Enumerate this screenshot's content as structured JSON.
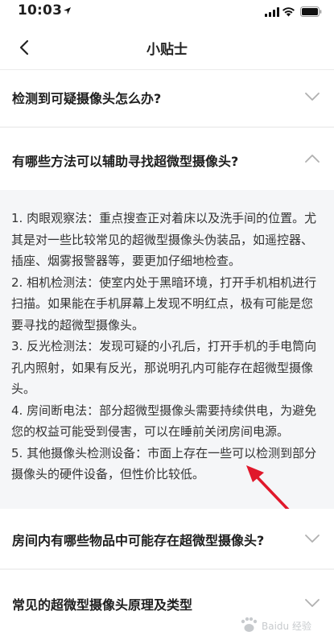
{
  "status_bar": {
    "time": "10:03"
  },
  "header": {
    "title": "小贴士"
  },
  "faq": [
    {
      "question": "检测到可疑摄像头怎么办?",
      "expanded": false
    },
    {
      "question": "有哪些方法可以辅助寻找超微型摄像头?",
      "expanded": true,
      "answer_lines": [
        "1. 肉眼观察法：重点搜查正对着床以及洗手间的位置。尤其是对一些比较常见的超微型摄像头伪装品，如遥控器、插座、烟雾报警器等，要更加仔细地检查。",
        "2. 相机检测法：使室内处于黑暗环境，打开手机相机进行扫描。如果能在手机屏幕上发现不明红点，极有可能是您要寻找的超微型摄像头。",
        "3. 反光检测法：发现可疑的小孔后，打开手机的手电筒向孔内照射，如果有反光，那说明孔内可能存在超微型摄像头。",
        "4. 房间断电法：部分超微型摄像头需要持续供电，为避免您的权益可能受到侵害，可以在睡前关闭房间电源。",
        "5. 其他摄像头检测设备：市面上存在一些可以检测到部分摄像头的硬件设备，但性价比较低。"
      ]
    },
    {
      "question": "房间内有哪些物品中可能存在超微型摄像头?",
      "expanded": false
    },
    {
      "question": "常见的超微型摄像头原理及类型",
      "expanded": false
    }
  ],
  "icons": {
    "back": "chevron-left-icon",
    "collapsed": "chevron-down-icon",
    "expanded": "chevron-up-icon"
  },
  "colors": {
    "answer_background": "#f5f6f8",
    "annotation_arrow": "#e0182b"
  },
  "watermark": "Baidu 经验"
}
